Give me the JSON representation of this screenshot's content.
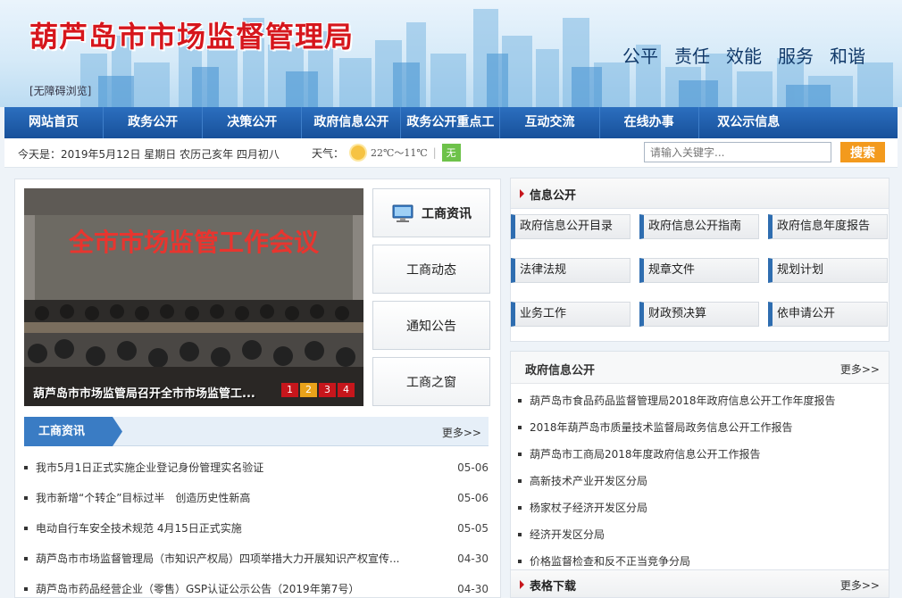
{
  "header": {
    "title": "葫芦岛市市场监督管理局",
    "accessible_link": "[无障碍浏览]",
    "slogans": [
      "公平",
      "责任",
      "效能",
      "服务",
      "和谐"
    ]
  },
  "nav": {
    "items": [
      "网站首页",
      "政务公开",
      "决策公开",
      "政府信息公开",
      "政务公开重点工作",
      "互动交流",
      "在线办事",
      "双公示信息"
    ]
  },
  "infobar": {
    "date": "今天是：2019年5月12日 星期日 农历己亥年 四月初八",
    "weather_label": "天气：",
    "temperature": "22℃～11℃",
    "air_quality": "无",
    "search_placeholder": "请输入关键字...",
    "search_button": "搜索"
  },
  "slider": {
    "banner_text": "全市市场监管工作会议",
    "caption": "葫芦岛市市场监管局召开全市市场监管工...",
    "pages": [
      "1",
      "2",
      "3",
      "4"
    ],
    "active_page": "2"
  },
  "tabs": [
    "工商资讯",
    "工商动态",
    "通知公告",
    "工商之窗"
  ],
  "news": {
    "title": "工商资讯",
    "more": "更多>>",
    "items": [
      {
        "title": "我市5月1日正式实施企业登记身份管理实名验证",
        "date": "05-06"
      },
      {
        "title": "我市新增“个转企”目标过半　创造历史性新高",
        "date": "05-06"
      },
      {
        "title": "电动自行车安全技术规范 4月15日正式实施",
        "date": "05-05"
      },
      {
        "title": "葫芦岛市市场监督管理局（市知识产权局）四项举措大力开展知识产权宣传...",
        "date": "04-30"
      },
      {
        "title": "葫芦岛市药品经营企业（零售）GSP认证公示公告（2019年第7号）",
        "date": "04-30"
      }
    ]
  },
  "info_public": {
    "title": "信息公开",
    "buttons": [
      "政府信息公开目录",
      "政府信息公开指南",
      "政府信息年度报告",
      "法律法规",
      "规章文件",
      "规划计划",
      "业务工作",
      "财政预决算",
      "依申请公开"
    ]
  },
  "gov_info": {
    "title": "政府信息公开",
    "more": "更多>>",
    "items": [
      "葫芦岛市食品药品监督管理局2018年政府信息公开工作年度报告",
      "2018年葫芦岛市质量技术监督局政务信息公开工作报告",
      "葫芦岛市工商局2018年度政府信息公开工作报告",
      "高新技术产业开发区分局",
      "杨家杖子经济开发区分局",
      "经济开发区分局",
      "价格监督检查和反不正当竞争分局"
    ]
  },
  "downloads": {
    "title": "表格下载",
    "more": "更多>>"
  },
  "colors": {
    "nav_blue": "#1a5aa8",
    "title_red": "#d6161c",
    "search_orange": "#f39a1d",
    "accent_blue": "#3a7cc4"
  }
}
